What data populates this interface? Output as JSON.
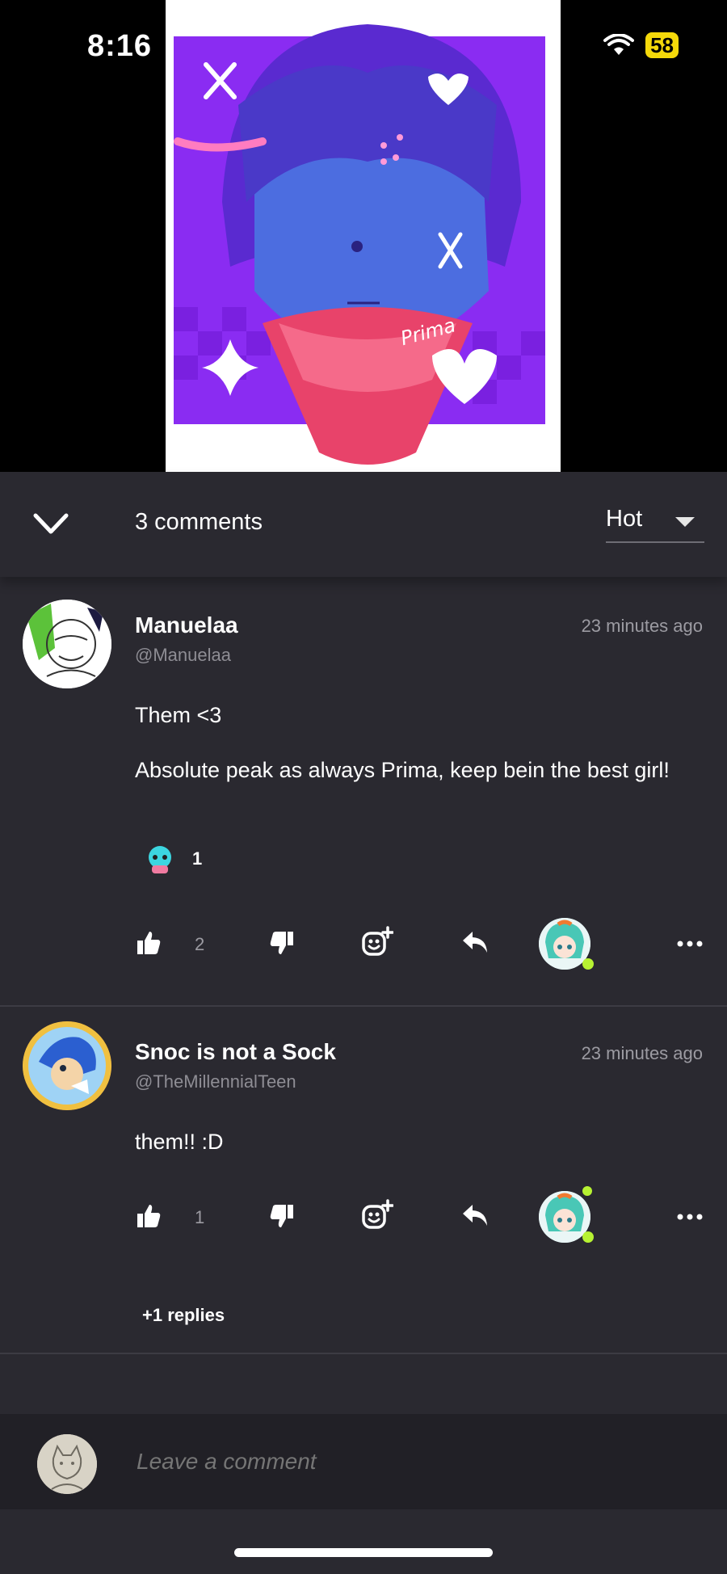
{
  "status_bar": {
    "time": "8:16",
    "battery": "58",
    "wifi_icon": "wifi-icon"
  },
  "artwork": {
    "signature": "Prima",
    "description_icon": "character-art"
  },
  "header": {
    "comment_count": "3 comments",
    "sort_label": "Hot"
  },
  "comments": [
    {
      "name": "Manuelaa",
      "handle": "@Manuelaa",
      "time": "23 minutes ago",
      "lines": [
        "Them <3",
        "Absolute peak as always Prima, keep bein the best girl!"
      ],
      "reaction_count": "1",
      "likes": "2"
    },
    {
      "name": "Snoc is not a Sock",
      "handle": "@TheMillennialTeen",
      "time": "23 minutes ago",
      "lines": [
        "them!! :D"
      ],
      "likes": "1",
      "replies": "+1 replies"
    }
  ],
  "footer": {
    "placeholder": "Leave a comment"
  },
  "colors": {
    "background": "#2a2930",
    "accent_online": "#b7f232",
    "battery": "#f5d90a"
  }
}
